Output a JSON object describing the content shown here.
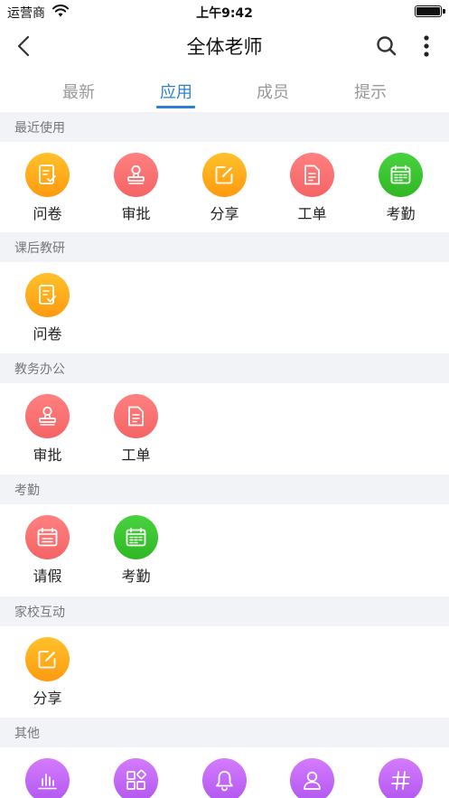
{
  "status_bar": {
    "carrier": "运营商",
    "time": "上午9:42"
  },
  "nav": {
    "title": "全体老师"
  },
  "tabs": [
    {
      "label": "最新"
    },
    {
      "label": "应用"
    },
    {
      "label": "成员"
    },
    {
      "label": "提示"
    }
  ],
  "active_tab": "应用",
  "sections": [
    {
      "title": "最近使用",
      "apps": [
        {
          "label": "问卷",
          "icon": "questionnaire-icon",
          "color": "#ffa516"
        },
        {
          "label": "审批",
          "icon": "approval-stamp-icon",
          "color": "#f56b6c"
        },
        {
          "label": "分享",
          "icon": "share-edit-icon",
          "color": "#ffa516"
        },
        {
          "label": "工单",
          "icon": "work-order-icon",
          "color": "#f56b6c"
        },
        {
          "label": "考勤",
          "icon": "attendance-calendar-icon",
          "color": "#3cc530"
        }
      ]
    },
    {
      "title": "课后教研",
      "apps": [
        {
          "label": "问卷",
          "icon": "questionnaire-icon",
          "color": "#ffa516"
        }
      ]
    },
    {
      "title": "教务办公",
      "apps": [
        {
          "label": "审批",
          "icon": "approval-stamp-icon",
          "color": "#f56b6c"
        },
        {
          "label": "工单",
          "icon": "work-order-icon",
          "color": "#f56b6c"
        }
      ]
    },
    {
      "title": "考勤",
      "apps": [
        {
          "label": "请假",
          "icon": "leave-calendar-icon",
          "color": "#f56b6c"
        },
        {
          "label": "考勤",
          "icon": "attendance-calendar-icon",
          "color": "#3cc530"
        }
      ]
    },
    {
      "title": "家校互动",
      "apps": [
        {
          "label": "分享",
          "icon": "share-edit-icon",
          "color": "#ffa516"
        }
      ]
    },
    {
      "title": "其他",
      "apps": [
        {
          "icon": "bar-chart-icon",
          "color": "#c06af8"
        },
        {
          "icon": "apps-grid-icon",
          "color": "#c06af8"
        },
        {
          "icon": "bell-icon",
          "color": "#c06af8"
        },
        {
          "icon": "person-icon",
          "color": "#c06af8"
        },
        {
          "icon": "hashtag-icon",
          "color": "#c06af8"
        }
      ]
    }
  ]
}
